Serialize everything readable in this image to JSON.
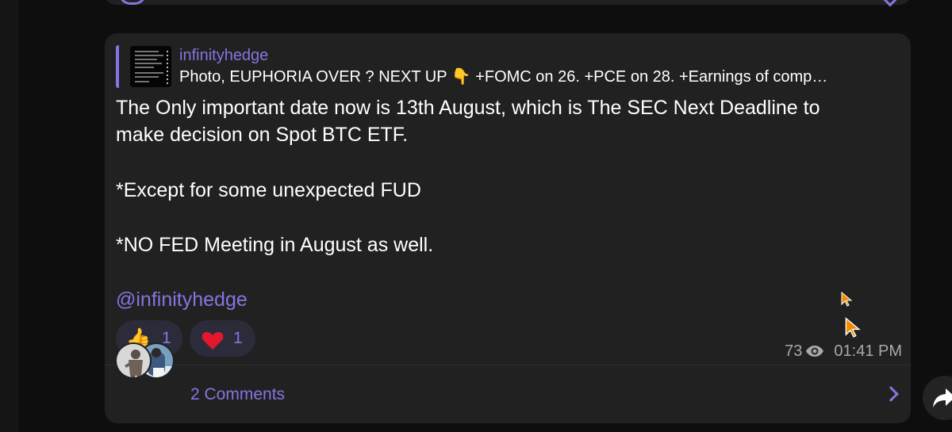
{
  "post": {
    "reply": {
      "author": "infinityhedge",
      "text": "Photo, EUPHORIA OVER ? NEXT UP 👇 +FOMC on 26. +PCE on 28. +Earnings of comp…"
    },
    "body": {
      "line1": "The Only important date now is 13th August, which is The SEC Next Deadline to",
      "line2": "make decision on Spot BTC ETF.",
      "line3": "*Except for some unexpected FUD",
      "line4": "*NO FED Meeting in August as well.",
      "mention": "@infinityhedge"
    },
    "reactions": [
      {
        "emoji": "👍",
        "icon": "thumbs-up-icon",
        "count": "1"
      },
      {
        "emoji": "❤️",
        "icon": "heart-icon",
        "count": "1"
      }
    ],
    "views": "73",
    "time": "01:41 PM",
    "comments": {
      "label": "2 Comments"
    }
  },
  "colors": {
    "accent": "#8774e1",
    "card_bg": "#212121",
    "page_bg": "#0e0e0e",
    "reaction_bg": "#2c2b3a",
    "meta_text": "#a8a8a8",
    "cursor": "#f08c00"
  },
  "icons": {
    "views": "eye-icon",
    "comments": "chevron-right-icon",
    "forward": "share-arrow-icon",
    "previous": "comment-bubble-icon"
  }
}
